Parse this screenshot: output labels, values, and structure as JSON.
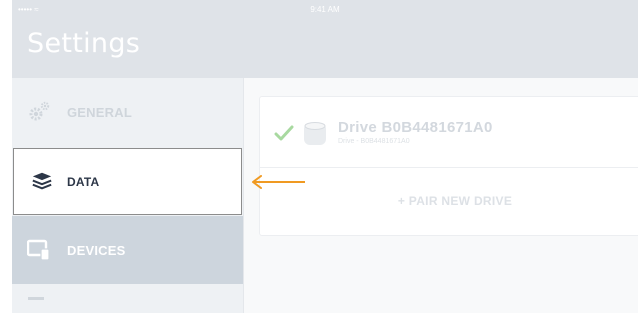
{
  "status_bar": {
    "signal": "••••• ≈",
    "time": "9:41 AM"
  },
  "header": {
    "title": "Settings"
  },
  "sidebar": {
    "items": [
      {
        "label": "GENERAL",
        "icon": "gears-icon"
      },
      {
        "label": "DATA",
        "icon": "layers-icon"
      },
      {
        "label": "DEVICES",
        "icon": "devices-icon"
      }
    ]
  },
  "drive": {
    "name": "Drive  B0B4481671A0",
    "subtitle": "Drive - B0B4481671A0",
    "status_icon": "check-icon"
  },
  "pair_button": {
    "label": "+ PAIR NEW DRIVE"
  },
  "colors": {
    "accent_arrow": "#f09a22",
    "check": "#a8d9a0",
    "header": "#dfe3e8"
  }
}
